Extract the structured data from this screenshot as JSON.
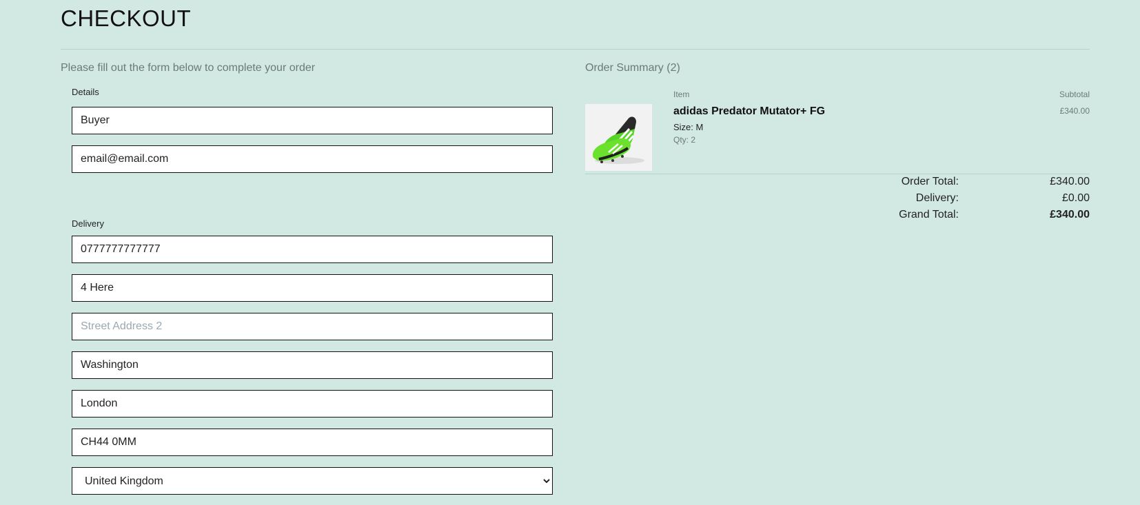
{
  "page": {
    "title": "CHECKOUT",
    "intro": "Please fill out the form below to complete your order"
  },
  "form": {
    "details_label": "Details",
    "full_name": "Buyer",
    "email": "email@email.com",
    "delivery_label": "Delivery",
    "phone": "0777777777777",
    "street_address_1": "4 Here",
    "street_address_2_placeholder": "Street Address 2",
    "town": "Washington",
    "county": "London",
    "postcode": "CH44 0MM",
    "country": "United Kingdom"
  },
  "summary": {
    "heading": "Order Summary (2)",
    "col_item": "Item",
    "col_subtotal": "Subtotal",
    "items": [
      {
        "name": "adidas Predator Mutator+ FG",
        "size": "Size: M",
        "qty": "Qty: 2",
        "subtotal": "£340.00",
        "image_icon": "green-football-boot-image"
      }
    ],
    "order_total_label": "Order Total:",
    "order_total": "£340.00",
    "delivery_label": "Delivery:",
    "delivery": "£0.00",
    "grand_total_label": "Grand Total:",
    "grand_total": "£340.00"
  },
  "colors": {
    "background": "#d2e8e2",
    "muted_text": "#6c7a77",
    "field_border": "#111111"
  }
}
